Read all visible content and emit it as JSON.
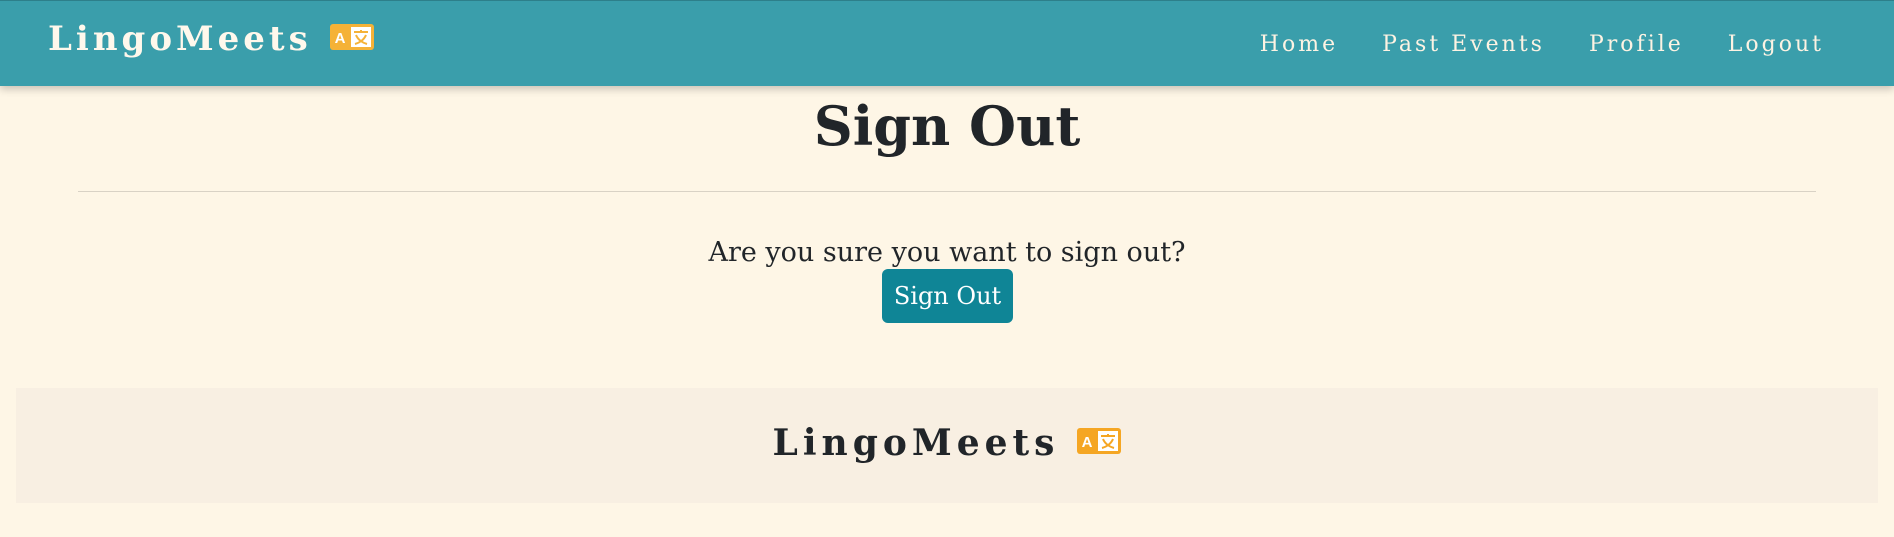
{
  "navbar": {
    "brand": "LingoMeets",
    "brand_icon": "translate-icon",
    "links": [
      {
        "label": "Home"
      },
      {
        "label": "Past Events"
      },
      {
        "label": "Profile"
      },
      {
        "label": "Logout"
      }
    ]
  },
  "main": {
    "title": "Sign Out",
    "question": "Are you sure you want to sign out?",
    "button_label": "Sign Out"
  },
  "footer": {
    "brand": "LingoMeets",
    "brand_icon": "translate-icon"
  },
  "colors": {
    "navbar_bg": "#3a9eab",
    "page_bg": "#fef6e6",
    "button_bg": "#0f8596",
    "icon_accent": "#f5a623",
    "footer_bg": "#f8efe2"
  }
}
